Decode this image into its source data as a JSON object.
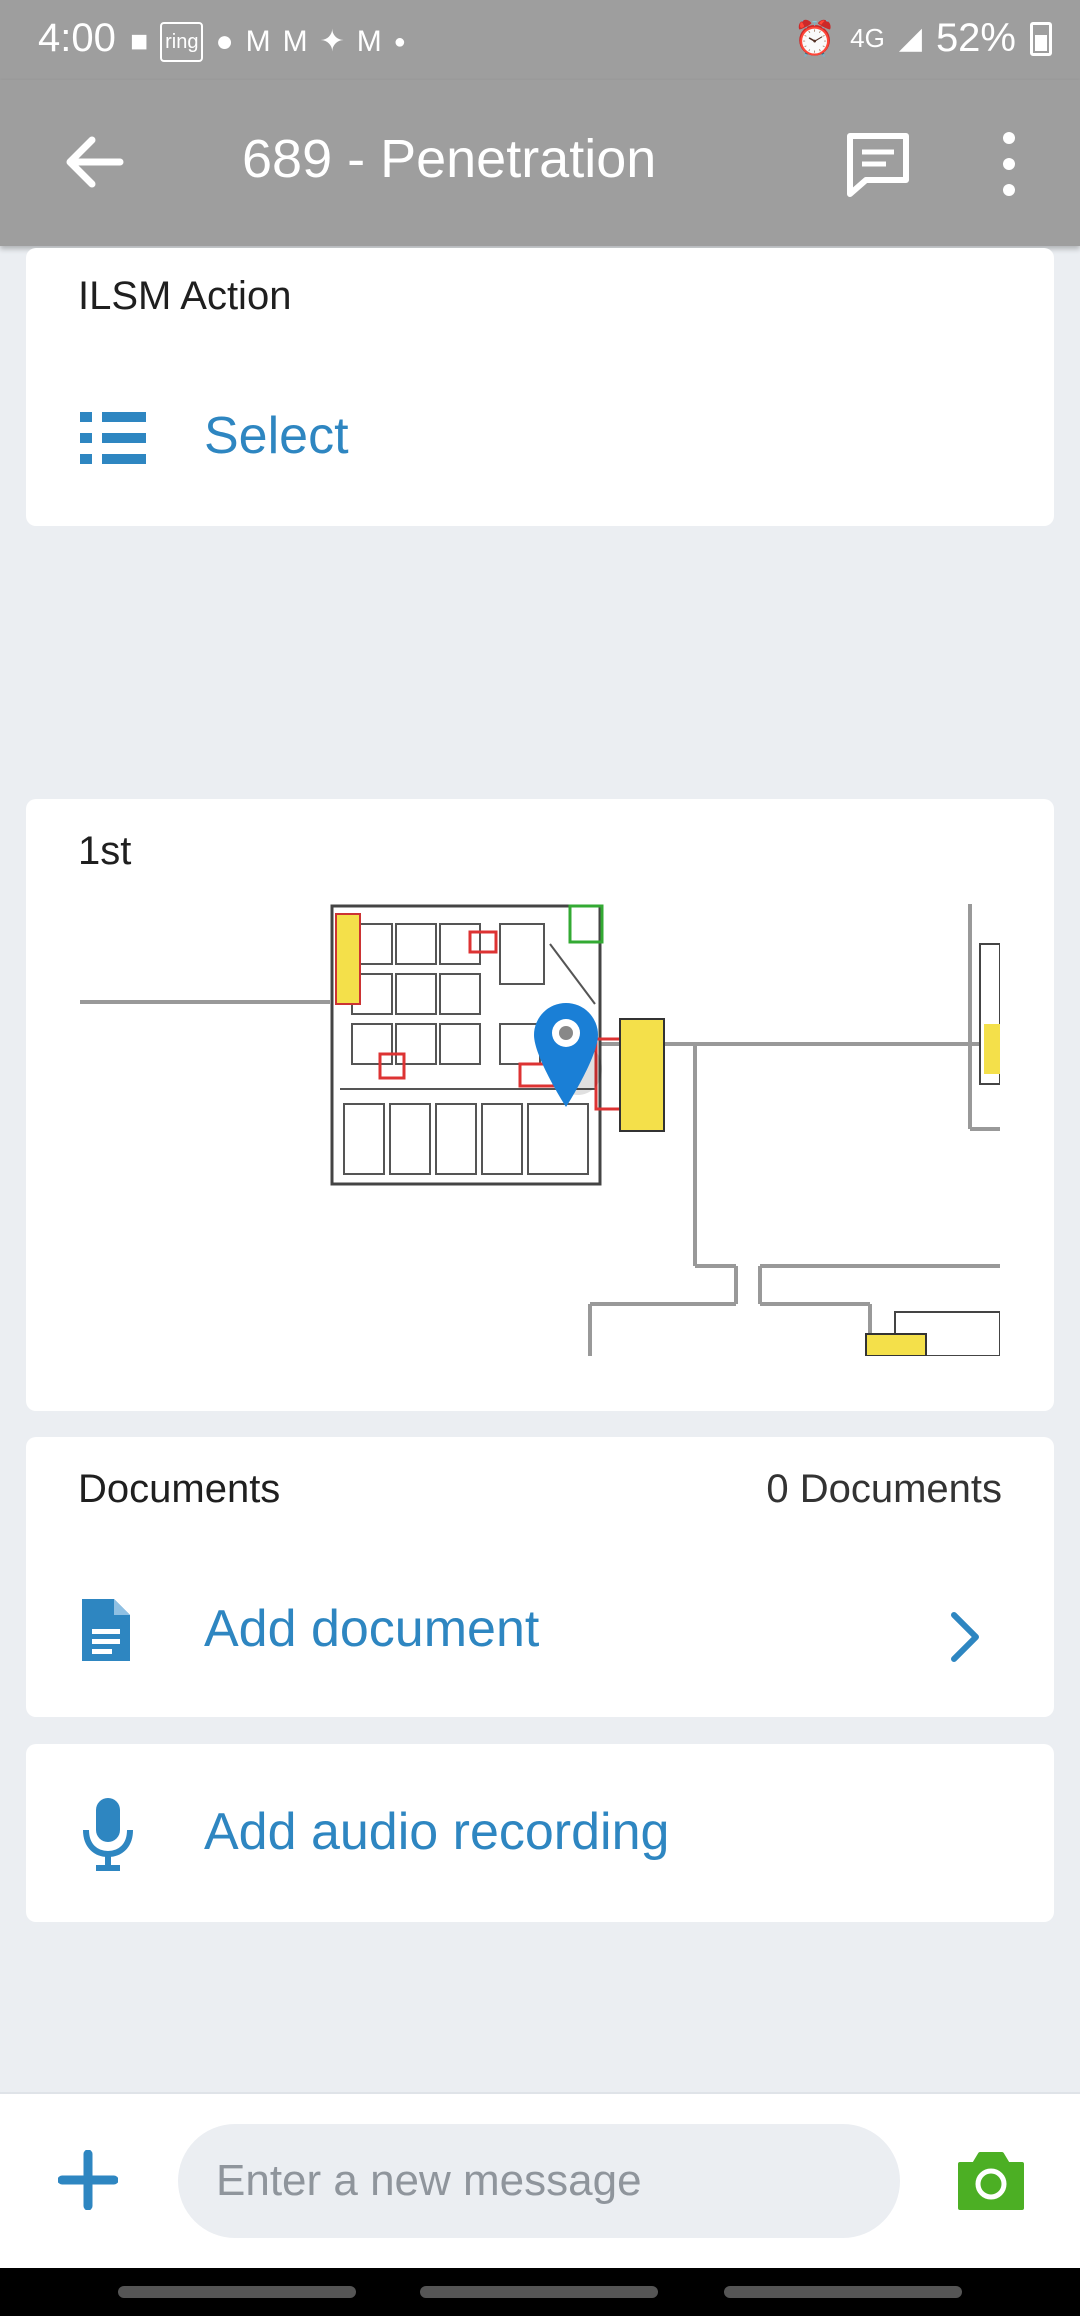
{
  "status_bar": {
    "time": "4:00",
    "notification_icons": [
      "message-icon",
      "ring-icon",
      "drop-icon",
      "gmail-icon",
      "gmail-icon",
      "twitter-icon",
      "gmail-icon",
      "dot-icon"
    ],
    "network": "4G",
    "battery": "52%"
  },
  "app_bar": {
    "title": "689 - Penetration",
    "back_icon": "arrow-back-icon",
    "chat_icon": "chat-icon",
    "more_icon": "more-vert-icon"
  },
  "ilsm_card": {
    "label": "ILSM Action",
    "select_label": "Select",
    "icon": "list-icon"
  },
  "floor_card": {
    "label": "1st",
    "marker_icon": "map-pin-icon"
  },
  "documents_card": {
    "label": "Documents",
    "count": "0 Documents",
    "add_label": "Add document",
    "icon": "document-icon"
  },
  "audio_card": {
    "add_label": "Add audio recording",
    "icon": "mic-icon"
  },
  "message_bar": {
    "placeholder": "Enter a new message",
    "value": ""
  },
  "colors": {
    "accent": "#2e86c1",
    "toolbar": "#9e9e9e",
    "background": "#ebeef2",
    "camera": "#4caf24"
  }
}
